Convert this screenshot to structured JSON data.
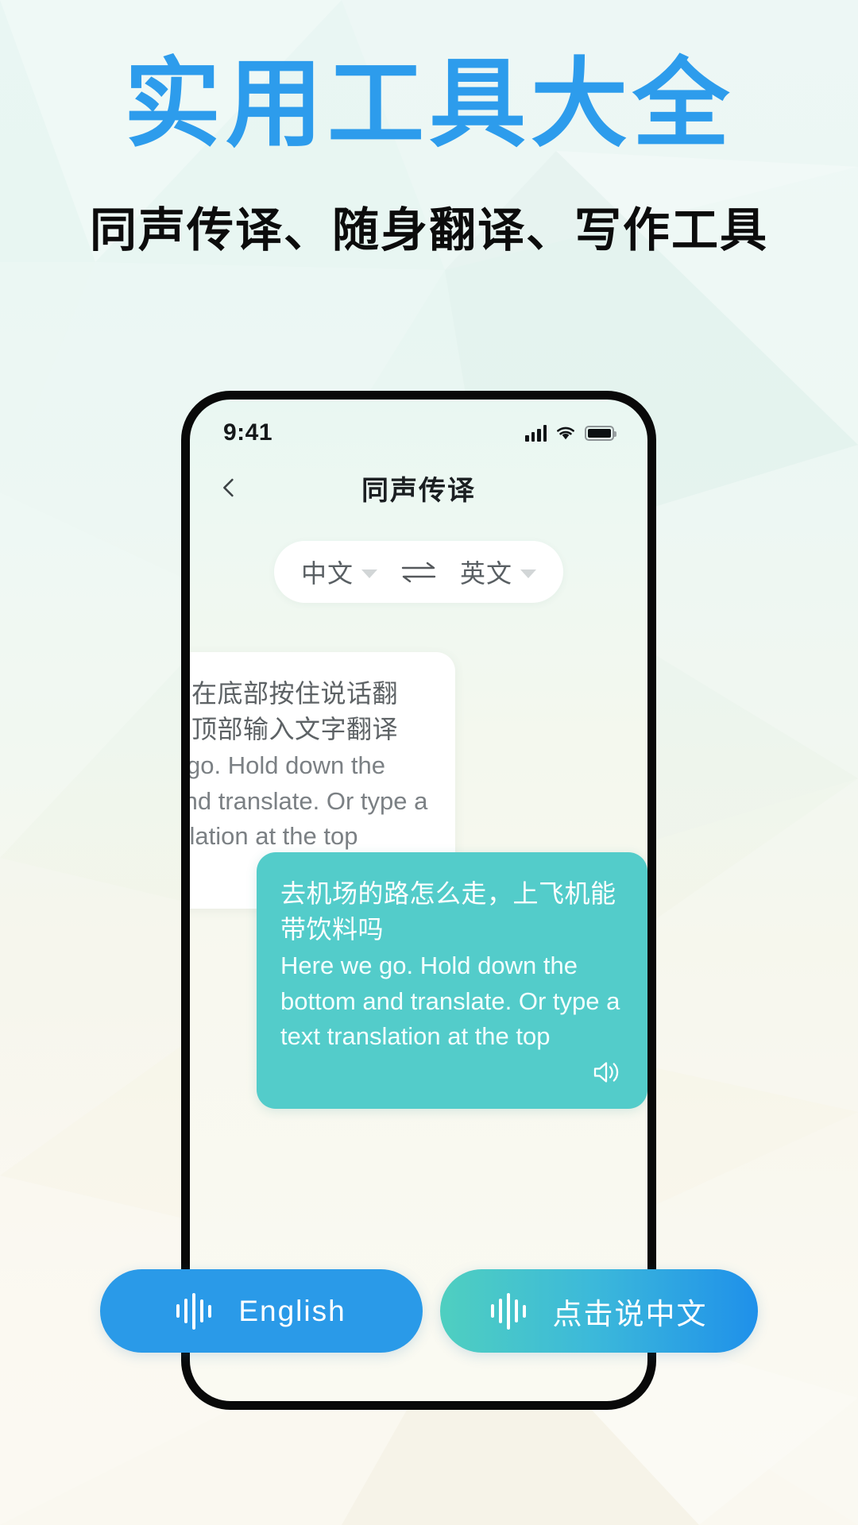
{
  "headline": {
    "title": "实用工具大全",
    "subtitle": "同声传译、随身翻译、写作工具",
    "title_color": "#2d9cec",
    "subtitle_color": "#0c0c0c"
  },
  "phone": {
    "status_bar": {
      "time": "9:41",
      "icons": [
        "signal-bars-icon",
        "wifi-icon",
        "battery-icon"
      ]
    },
    "nav": {
      "back_icon": "chevron-left-icon",
      "title": "同声传译"
    },
    "language_bar": {
      "source": "中文",
      "target": "英文",
      "source_caret": "chevron-down-icon",
      "target_caret": "chevron-down-icon",
      "swap_icon": "swap-arrows-icon"
    },
    "messages": [
      {
        "side": "left",
        "zh": "开始吧，在底部按住说话翻译。或在顶部输入文字翻译",
        "en": "Here we go. Hold down the bottom and translate. Or type a text translation at the top",
        "speaker_icon": "speaker-icon",
        "bg": "#ffffff"
      },
      {
        "side": "right",
        "zh": "去机场的路怎么走，上飞机能带饮料吗",
        "en": "Here we go. Hold down the bottom and translate. Or type a text translation at the top",
        "speaker_icon": "speaker-icon",
        "bg": "#53ccca"
      }
    ]
  },
  "bottom_buttons": [
    {
      "label": "English",
      "icon": "waveform-icon",
      "color": "#2a9ae8"
    },
    {
      "label": "点击说中文",
      "icon": "waveform-icon",
      "color": "#4fcfc0"
    }
  ]
}
